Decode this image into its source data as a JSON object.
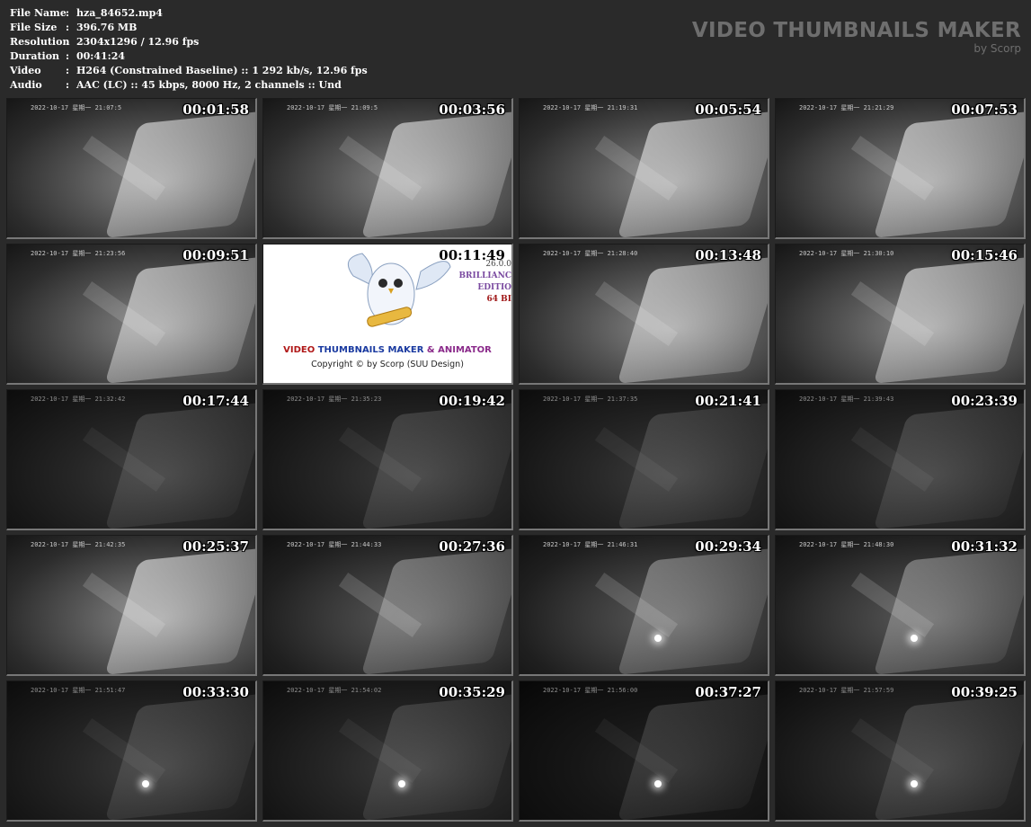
{
  "info": [
    {
      "key": "File Name",
      "sep": ":",
      "value": "hza_84652.mp4"
    },
    {
      "key": "File Size",
      "sep": ":",
      "value": "396.76 MB"
    },
    {
      "key": "Resolution",
      "sep": ":",
      "value": "2304x1296 / 12.96 fps"
    },
    {
      "key": "Duration",
      "sep": ":",
      "value": "00:41:24"
    },
    {
      "key": "Video",
      "sep": ":",
      "value": "H264 (Constrained Baseline) :: 1 292 kb/s, 12.96 fps"
    },
    {
      "key": "Audio",
      "sep": ":",
      "value": "AAC (LC) :: 45 kbps, 8000 Hz, 2 channels :: Und"
    }
  ],
  "brand": {
    "title": "VIDEO THUMBNAILS MAKER",
    "subtitle": "by Scorp"
  },
  "logo": {
    "title_part1": "VIDEO ",
    "title_part2": "THUMBNAILS MAKER",
    "title_part3": " & ANIMATOR",
    "copyright": "Copyright © by Scorp (SUU Design)",
    "version": "26.0.0",
    "edition_line1": "BRILLIANC",
    "edition_line2": "EDITIO",
    "bits": "64 BI"
  },
  "thumbs": [
    {
      "tc": "00:01:58",
      "cam": "2022-10-17 星期一 21:07:5",
      "tone": "bright",
      "lamp": false
    },
    {
      "tc": "00:03:56",
      "cam": "2022-10-17 星期一 21:09:5",
      "tone": "bright",
      "lamp": false
    },
    {
      "tc": "00:05:54",
      "cam": "2022-10-17 星期一 21:19:31",
      "tone": "bright",
      "lamp": false
    },
    {
      "tc": "00:07:53",
      "cam": "2022-10-17 星期一 21:21:29",
      "tone": "bright",
      "lamp": false
    },
    {
      "tc": "00:09:51",
      "cam": "2022-10-17 星期一 21:23:56",
      "tone": "bright",
      "lamp": false
    },
    {
      "tc": "00:11:49",
      "cam": "",
      "tone": "logo",
      "lamp": false
    },
    {
      "tc": "00:13:48",
      "cam": "2022-10-17 星期一 21:28:40",
      "tone": "bright",
      "lamp": false
    },
    {
      "tc": "00:15:46",
      "cam": "2022-10-17 星期一 21:30:10",
      "tone": "bright",
      "lamp": false
    },
    {
      "tc": "00:17:44",
      "cam": "2022-10-17 星期一 21:32:42",
      "tone": "dark",
      "lamp": false
    },
    {
      "tc": "00:19:42",
      "cam": "2022-10-17 星期一 21:35:23",
      "tone": "dark",
      "lamp": false
    },
    {
      "tc": "00:21:41",
      "cam": "2022-10-17 星期一 21:37:35",
      "tone": "dark",
      "lamp": false
    },
    {
      "tc": "00:23:39",
      "cam": "2022-10-17 星期一 21:39:43",
      "tone": "dark",
      "lamp": false
    },
    {
      "tc": "00:25:37",
      "cam": "2022-10-17 星期一 21:42:35",
      "tone": "bright",
      "lamp": false
    },
    {
      "tc": "00:27:36",
      "cam": "2022-10-17 星期一 21:44:33",
      "tone": "mid",
      "lamp": false
    },
    {
      "tc": "00:29:34",
      "cam": "2022-10-17 星期一 21:46:31",
      "tone": "mid",
      "lamp": true
    },
    {
      "tc": "00:31:32",
      "cam": "2022-10-17 星期一 21:48:30",
      "tone": "mid",
      "lamp": true
    },
    {
      "tc": "00:33:30",
      "cam": "2022-10-17 星期一 21:51:47",
      "tone": "dark",
      "lamp": true
    },
    {
      "tc": "00:35:29",
      "cam": "2022-10-17 星期一 21:54:02",
      "tone": "dark",
      "lamp": true
    },
    {
      "tc": "00:37:27",
      "cam": "2022-10-17 星期一 21:56:00",
      "tone": "vdark",
      "lamp": true
    },
    {
      "tc": "00:39:25",
      "cam": "2022-10-17 星期一 21:57:59",
      "tone": "dark",
      "lamp": true
    }
  ]
}
